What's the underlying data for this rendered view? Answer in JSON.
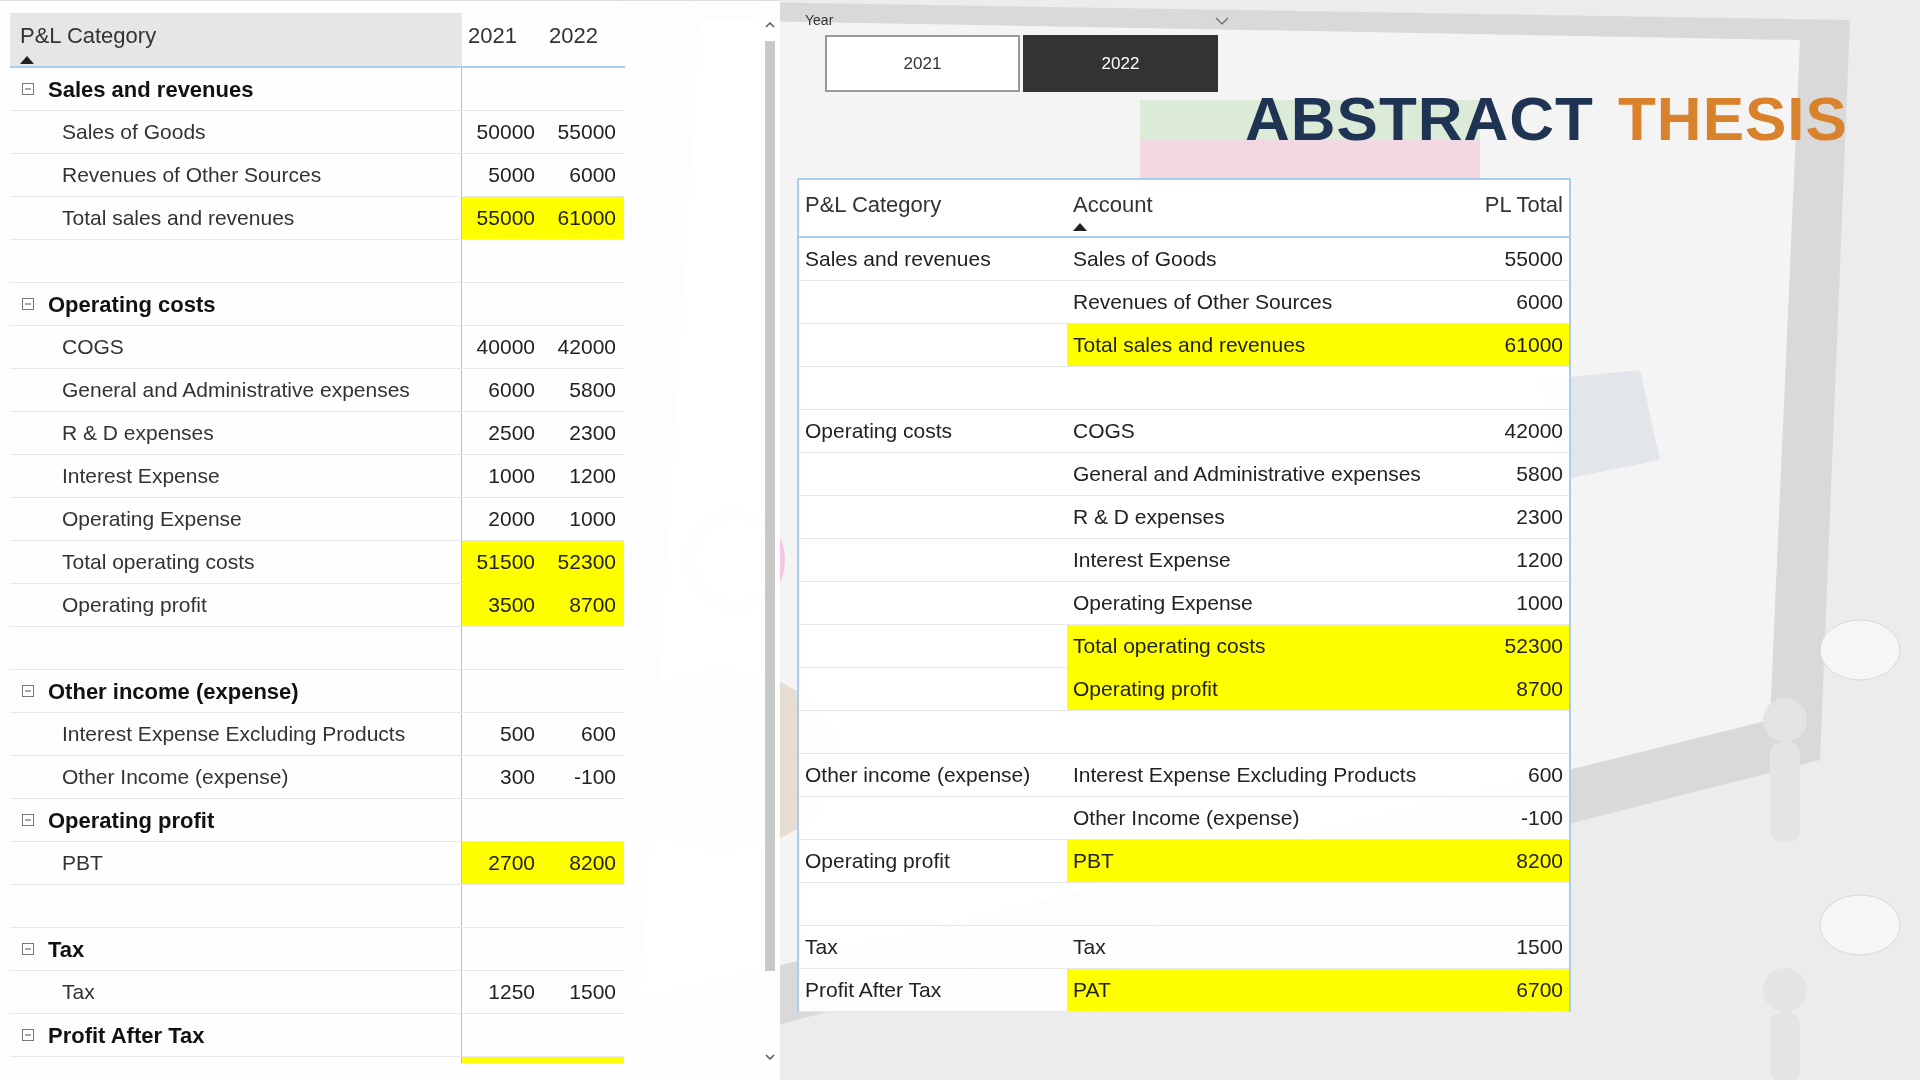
{
  "matrix": {
    "columns": [
      "P&L Category",
      "2021",
      "2022"
    ],
    "rows": [
      {
        "kind": "group",
        "label": "Sales and revenues",
        "expanded": true
      },
      {
        "kind": "item",
        "label": "Sales of Goods",
        "values": [
          "50000",
          "55000"
        ],
        "highlight": false
      },
      {
        "kind": "item",
        "label": "Revenues of Other Sources",
        "values": [
          "5000",
          "6000"
        ],
        "highlight": false
      },
      {
        "kind": "item",
        "label": "Total sales and revenues",
        "values": [
          "55000",
          "61000"
        ],
        "highlight": true
      },
      {
        "kind": "blank"
      },
      {
        "kind": "group",
        "label": "Operating costs",
        "expanded": true
      },
      {
        "kind": "item",
        "label": "COGS",
        "values": [
          "40000",
          "42000"
        ],
        "highlight": false
      },
      {
        "kind": "item",
        "label": "General and Administrative expenses",
        "values": [
          "6000",
          "5800"
        ],
        "highlight": false
      },
      {
        "kind": "item",
        "label": "R & D expenses",
        "values": [
          "2500",
          "2300"
        ],
        "highlight": false
      },
      {
        "kind": "item",
        "label": "Interest Expense",
        "values": [
          "1000",
          "1200"
        ],
        "highlight": false
      },
      {
        "kind": "item",
        "label": "Operating Expense",
        "values": [
          "2000",
          "1000"
        ],
        "highlight": false
      },
      {
        "kind": "item",
        "label": "Total operating costs",
        "values": [
          "51500",
          "52300"
        ],
        "highlight": true
      },
      {
        "kind": "item",
        "label": "Operating profit",
        "values": [
          "3500",
          "8700"
        ],
        "highlight": true
      },
      {
        "kind": "blank"
      },
      {
        "kind": "group",
        "label": "Other income (expense)",
        "expanded": true
      },
      {
        "kind": "item",
        "label": "Interest Expense Excluding Products",
        "values": [
          "500",
          "600"
        ],
        "highlight": false
      },
      {
        "kind": "item",
        "label": "Other Income (expense)",
        "values": [
          "300",
          "-100"
        ],
        "highlight": false
      },
      {
        "kind": "group",
        "label": "Operating profit",
        "expanded": true
      },
      {
        "kind": "item",
        "label": "PBT",
        "values": [
          "2700",
          "8200"
        ],
        "highlight": true
      },
      {
        "kind": "blank"
      },
      {
        "kind": "group",
        "label": "Tax",
        "expanded": true
      },
      {
        "kind": "item",
        "label": "Tax",
        "values": [
          "1250",
          "1500"
        ],
        "highlight": false
      },
      {
        "kind": "group",
        "label": "Profit After Tax",
        "expanded": true
      },
      {
        "kind": "cut",
        "highlight": true
      }
    ]
  },
  "year_slicer": {
    "title": "Year",
    "options": [
      {
        "label": "2021",
        "selected": false
      },
      {
        "label": "2022",
        "selected": true
      }
    ]
  },
  "logo": {
    "words": [
      {
        "text": "ABSTRACT",
        "color": "#1f3352"
      },
      {
        "text": "THESIS",
        "color": "#d9822b"
      }
    ]
  },
  "table": {
    "columns": [
      "P&L Category",
      "Account",
      "PL Total"
    ],
    "rows": [
      {
        "kind": "row",
        "category": "Sales and revenues",
        "account": "Sales of Goods",
        "total": "55000",
        "highlight": false
      },
      {
        "kind": "row",
        "account": "Revenues of Other Sources",
        "total": "6000",
        "highlight": false
      },
      {
        "kind": "row",
        "account": "Total sales and revenues",
        "total": "61000",
        "highlight": true
      },
      {
        "kind": "blank"
      },
      {
        "kind": "row",
        "category": "Operating costs",
        "account": "COGS",
        "total": "42000",
        "highlight": false
      },
      {
        "kind": "row",
        "account": "General and Administrative expenses",
        "total": "5800",
        "highlight": false
      },
      {
        "kind": "row",
        "account": "R & D expenses",
        "total": "2300",
        "highlight": false
      },
      {
        "kind": "row",
        "account": "Interest Expense",
        "total": "1200",
        "highlight": false
      },
      {
        "kind": "row",
        "account": "Operating Expense",
        "total": "1000",
        "highlight": false
      },
      {
        "kind": "row",
        "account": "Total operating costs",
        "total": "52300",
        "highlight": true
      },
      {
        "kind": "row",
        "account": "Operating profit",
        "total": "8700",
        "highlight": true
      },
      {
        "kind": "blank"
      },
      {
        "kind": "row",
        "category": "Other income (expense)",
        "account": "Interest Expense Excluding Products",
        "total": "600",
        "highlight": false
      },
      {
        "kind": "row",
        "account": "Other Income (expense)",
        "total": "-100",
        "highlight": false
      },
      {
        "kind": "row",
        "category": "Operating profit",
        "account": "PBT",
        "total": "8200",
        "highlight": true
      },
      {
        "kind": "blank"
      },
      {
        "kind": "row",
        "category": "Tax",
        "account": "Tax",
        "total": "1500",
        "highlight": false
      },
      {
        "kind": "row",
        "category": "Profit After Tax",
        "account": "PAT",
        "total": "6700",
        "highlight": true
      }
    ]
  }
}
